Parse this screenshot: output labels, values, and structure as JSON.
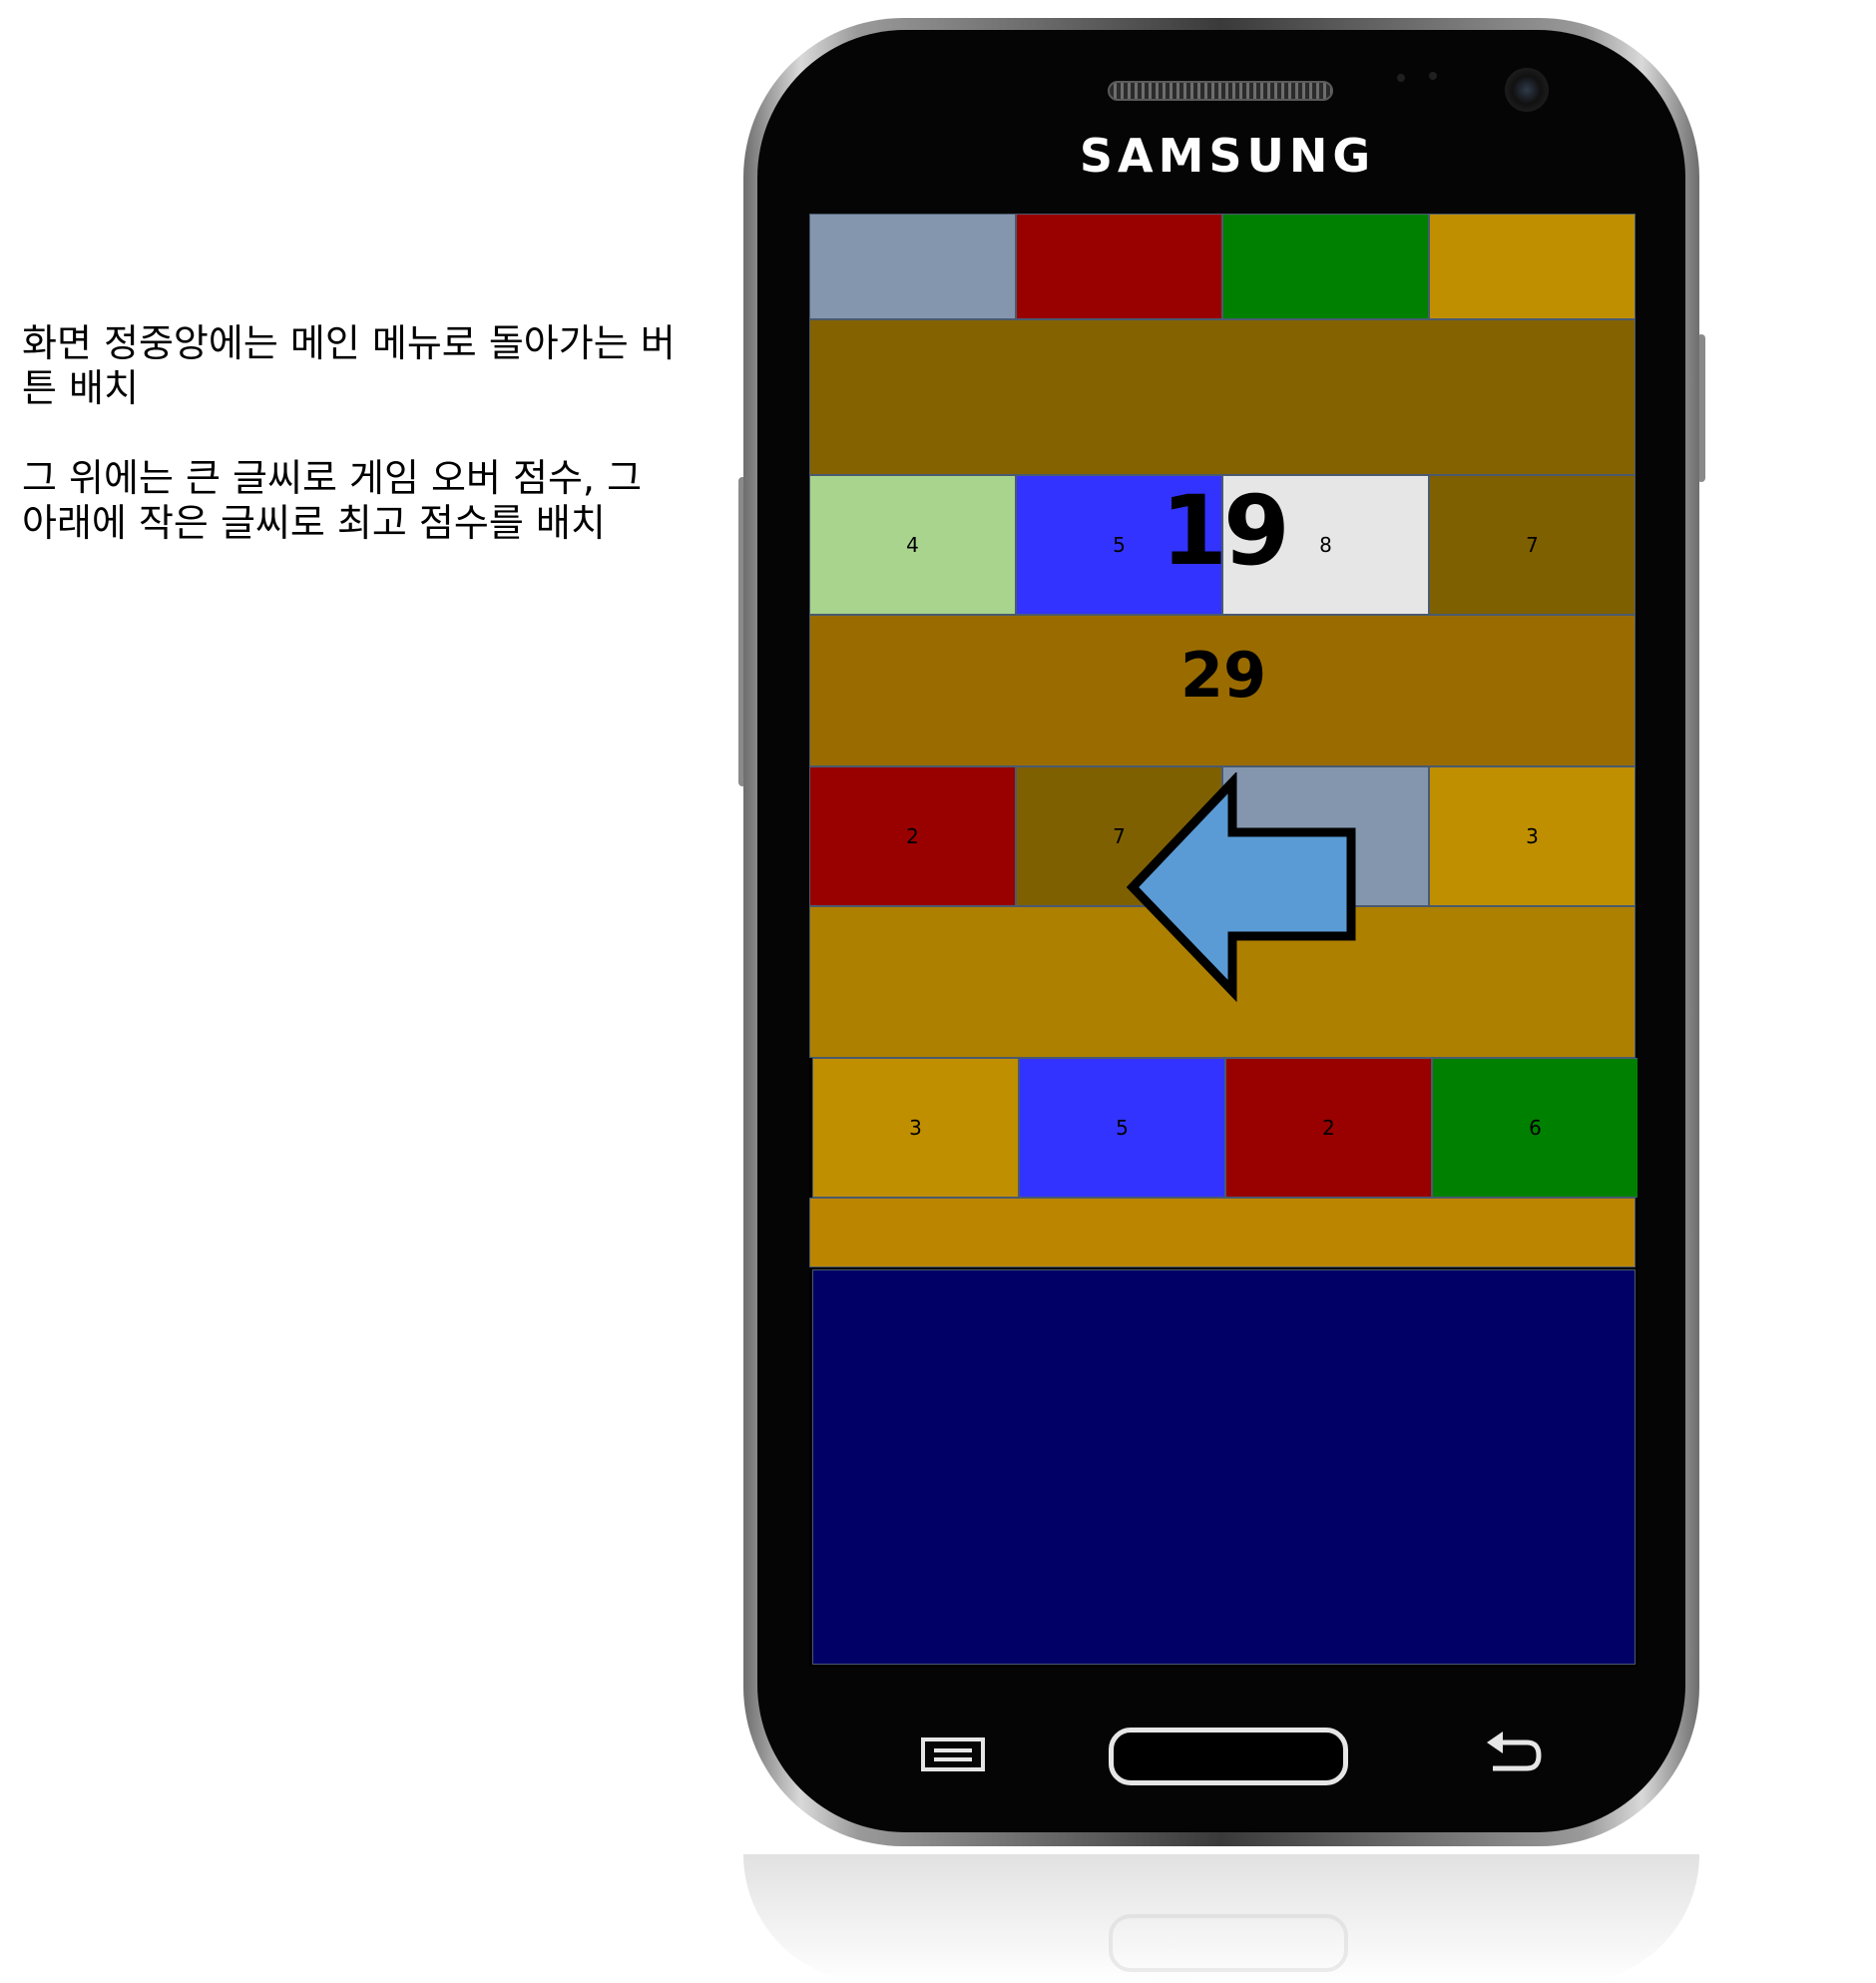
{
  "annotation": {
    "line1": "화면 정중앙에는 메인 메뉴로 돌아가는 버튼 배치",
    "line2": "그 위에는 큰 글씨로 게임 오버 점수, 그 아래에 작은 글씨로 최고 점수를 배치"
  },
  "device": {
    "brand": "SAMSUNG"
  },
  "game": {
    "score": "19",
    "best_score": "29",
    "rows": [
      {
        "tiles": [
          {
            "label": "",
            "color": "#8496ae"
          },
          {
            "label": "",
            "color": "#990000"
          },
          {
            "label": "",
            "color": "#008000"
          },
          {
            "label": "",
            "color": "#bf8f00"
          }
        ],
        "band_color": "#856200"
      },
      {
        "tiles": [
          {
            "label": "4",
            "color": "#a8d48e"
          },
          {
            "label": "5",
            "color": "#3333ff"
          },
          {
            "label": "8",
            "color": "#e6e6e6"
          },
          {
            "label": "7",
            "color": "#7f6000"
          }
        ],
        "band_color": "#9a6c00"
      },
      {
        "tiles": [
          {
            "label": "2",
            "color": "#990000"
          },
          {
            "label": "7",
            "color": "#7f6000"
          },
          {
            "label": "",
            "color": "#8496ae"
          },
          {
            "label": "3",
            "color": "#bf8f00"
          }
        ],
        "band_color": "#ae8000"
      },
      {
        "tiles": [
          {
            "label": "3",
            "color": "#bf8f00"
          },
          {
            "label": "5",
            "color": "#3333ff"
          },
          {
            "label": "2",
            "color": "#990000"
          },
          {
            "label": "6",
            "color": "#008000"
          }
        ],
        "band_color": "#bb8500"
      }
    ],
    "bottom_panel_color": "#000066",
    "back_arrow_color": "#5b9bd5"
  }
}
